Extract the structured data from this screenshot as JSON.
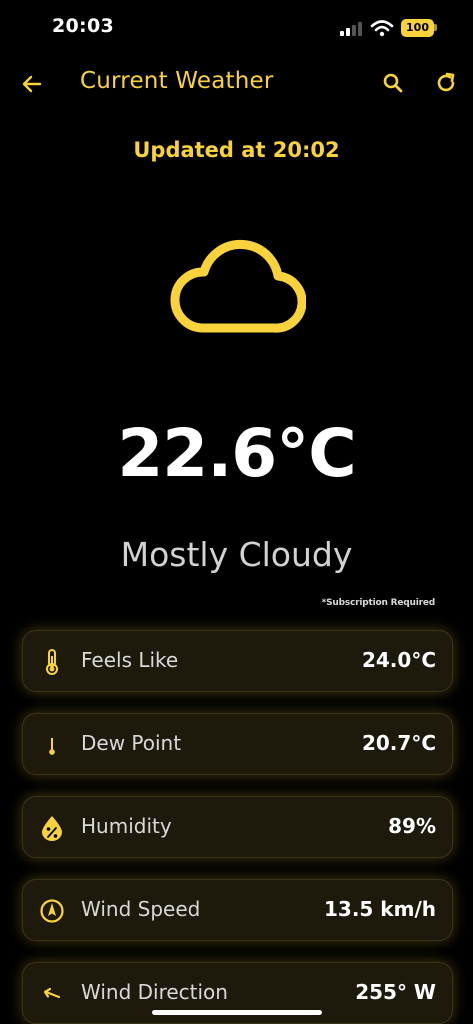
{
  "status_bar": {
    "time": "20:03",
    "battery": "100"
  },
  "header": {
    "title": "Current Weather"
  },
  "updated_text": "Updated at 20:02",
  "current": {
    "icon": "cloud-icon",
    "temperature": "22.6°C",
    "condition": "Mostly Cloudy"
  },
  "subscription_note": "*Subscription Required",
  "details": [
    {
      "icon": "thermometer-icon",
      "label": "Feels Like",
      "value": "24.0°C"
    },
    {
      "icon": "dew-point-icon",
      "label": "Dew Point",
      "value": "20.7°C"
    },
    {
      "icon": "humidity-icon",
      "label": "Humidity",
      "value": "89%"
    },
    {
      "icon": "compass-icon",
      "label": "Wind Speed",
      "value": "13.5 km/h"
    },
    {
      "icon": "wind-direction-arrow-icon",
      "label": "Wind Direction",
      "value": "255° W"
    }
  ],
  "colors": {
    "accent": "#f9d23c",
    "background": "#000000",
    "card": "#1d1a0c"
  }
}
